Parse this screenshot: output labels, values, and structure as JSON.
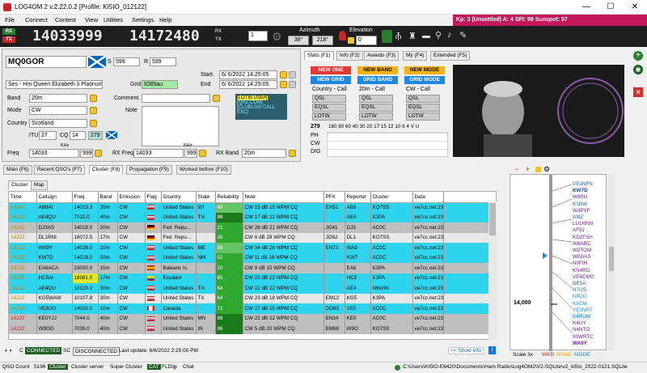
{
  "window": {
    "title": "LOG4OM 2 v.2.22.0.2 [Profile: KI5IO_012122]",
    "min": "—",
    "max": "☐",
    "close": "✕"
  },
  "menu": [
    "File",
    "Connect",
    "Contest",
    "View",
    "Utilities",
    "Settings",
    "Help"
  ],
  "kp": "Kp: 3 (Unsettled)  A: 4  SFI: 99  Sunspot: 57",
  "toolbar": {
    "rx": "RX",
    "tx": "TX",
    "rx_freq": "14033999",
    "tx_freq": "14172480",
    "rx2": "RX",
    "tx2": "TX",
    "step": "1",
    "azimuth_label": "Azimuth",
    "azimuth": "38°",
    "azimuth2": "218°",
    "elevation_label": "Elevation",
    "elevation": "0"
  },
  "qso": {
    "callsign": "MQ0GOR",
    "s_label": "S",
    "s_val": "599",
    "r_label": "R",
    "r_val": "599",
    "start_label": "Start",
    "start": "6/ 6/2022 14:25:05",
    "end_label": "End",
    "end": "6/ 6/2022 14:25:05",
    "name": "Ses - Hm Queen Elizabeth Ii Platinum Jubilee",
    "grid_label": "Grid",
    "grid": "IO85au",
    "band_label": "Band",
    "band": "20m",
    "comment_label": "Comment",
    "mode_label": "Mode",
    "mode": "CW",
    "note_label": "Note",
    "country_label": "Country",
    "country": "Scotland",
    "itu_label": "ITU",
    "itu": "27",
    "cq_label": "CQ",
    "cq": "14",
    "dxcc": "279",
    "khz1": "KHz",
    "khz2": "KHz",
    "freq_label": "Freq",
    "freq": "14033",
    "freq_dec": "999",
    "rxfreq_label": "RX Freq",
    "rxfreq": "14033",
    "rxfreq_dec": "999",
    "rxband_label": "RX Band",
    "rxband": "20m",
    "lotw": [
      "[LOTW USER]",
      "[QRZ.COM]",
      "[CLUBLOG CALL EXC]"
    ]
  },
  "stats": {
    "tabs": [
      "Stats (F1)",
      "Info (F2)",
      "Awards (F3)",
      "My (F4)",
      "Extended (F5)"
    ],
    "buttons": [
      "NEW ONE",
      "NEW BAND",
      "NEW MODE",
      "NEW GRID",
      "GRID BAND",
      "GRID MODE"
    ],
    "cols": [
      "Country - Call",
      "20m - Call",
      "CW - Call"
    ],
    "qsl": [
      "QSL",
      "EQSL",
      "LOTW"
    ],
    "dxcc": "279",
    "bands": [
      "160",
      "80",
      "60",
      "40",
      "30",
      "20",
      "17",
      "15",
      "12",
      "10",
      "6",
      "4",
      "V",
      "U"
    ],
    "rows": [
      "PH",
      "CW",
      "DIG"
    ]
  },
  "lower_tabs": [
    "Main (F6)",
    "Recent QSO's (F7)",
    "Cluster (F8)",
    "Propagation (F9)",
    "Worked before (F10)"
  ],
  "sub_tabs": [
    "Cluster",
    "Map"
  ],
  "cluster": {
    "headers": [
      "Time",
      "Callsign",
      "Freq",
      "Band",
      "Emission",
      "Flag",
      "Country",
      "State",
      "Reliability",
      "Note",
      "PFX",
      "Reporter",
      "Cluster",
      "Data"
    ],
    "rows": [
      [
        "1424Z",
        "AB9AI",
        "14015.3",
        "20m",
        "CW",
        "us",
        "United States",
        "WI",
        "49",
        "CW 15 dB 15 WPM CQ",
        "EN52",
        "AB9",
        "KO7SS",
        "ve7cc.net:23",
        "Spot",
        "cy",
        "rel-lg"
      ],
      [
        "1424Z",
        "AE4QU",
        "7032.0",
        "40m",
        "CW",
        "us",
        "United States",
        "TN",
        "98",
        "CW 17 dB 22 WPM CQ",
        "",
        "AE4",
        "K3PA",
        "ve7cc.net:23",
        "Spot",
        "cy",
        "rel-dg"
      ],
      [
        "1424Z",
        "DJ3AS",
        "14018.0",
        "20m",
        "CW",
        "de",
        "Fed. Repu...",
        "",
        "21",
        "CW 26 dB 21 WPM CQ",
        "JO41",
        "DJ3",
        "AC0C",
        "ve7cc.net:23",
        "Spot",
        "gy",
        "rel-g"
      ],
      [
        "1423Z",
        "DL1RNI",
        "18072.5",
        "17m",
        "CW",
        "de",
        "Fed. Repu...",
        "",
        "26",
        "CW  6 dB 28 WPM CQ",
        "JO62",
        "DL1",
        "KO7SS",
        "ve7cc.net:23",
        "Spot",
        "lg",
        "rel-g"
      ],
      [
        "1423Z",
        "WA9Y",
        "14026.0",
        "20m",
        "CW",
        "us",
        "United States",
        "ME",
        "49",
        "CW 34 dB 28 WPM CQ",
        "EN73",
        "WA9",
        "AC0C",
        "ve7cc.net:23",
        "Spot",
        "cy",
        "rel-lg"
      ],
      [
        "1423Z",
        "KW7D",
        "14018.0",
        "20m",
        "CW",
        "us",
        "United States",
        "NM",
        "52",
        "CW 11 dB 18 WPM CQ",
        "",
        "KW7",
        "AC0C",
        "ve7cc.net:23",
        "Spot",
        "cy",
        "rel-g"
      ],
      [
        "1423Z",
        "EA6ACA",
        "23030.0",
        "15m",
        "CW",
        "es",
        "Balearic Is.",
        "",
        "10",
        "CW  9 dB 15 WPM CQ",
        "",
        "EA6",
        "K3PA",
        "ve7cc.net:23",
        "Spot",
        "gy",
        "rel-g"
      ],
      [
        "1423Z",
        "HC5AI",
        "18081.0",
        "17m",
        "CW",
        "ec",
        "Ecuador",
        "",
        "65",
        "CW 22 dB 22 WPM CQ",
        "",
        "HC5",
        "K3PA",
        "ve7cc.net:23",
        "Spot",
        "cy",
        "rel-g"
      ],
      [
        "1422Z",
        "AE4QU",
        "10120.0",
        "30m",
        "CW",
        "us",
        "United States",
        "TN",
        "64",
        "CW 22 dB 22 WPM CQ",
        "",
        "AE4",
        "N6WIN",
        "ve7cc.net:23",
        "Spot",
        "cy",
        "rel-g"
      ],
      [
        "1422Z",
        "KG5WAW",
        "10107.8",
        "30m",
        "CW",
        "us",
        "United States",
        "TX",
        "64",
        "CW 23 dB 18 WPM CQ",
        "EM12",
        "KG5",
        "K3PA",
        "ve7cc.net:23",
        "Spot",
        "lg",
        "rel-g"
      ],
      [
        "1422Z",
        "VE3UO",
        "14020.0",
        "20m",
        "CW",
        "ca",
        "Canada",
        "",
        "71",
        "CW 27 dB 25 WPM CQ",
        "DO62",
        "VE5",
        "AC0C",
        "ve7cc.net:23",
        "Spot",
        "cy",
        "rel-g"
      ],
      [
        "1422Z",
        "KE0YJJ",
        "7044.0",
        "40m",
        "CW",
        "us",
        "United States",
        "MN",
        "96",
        "CW 22 dB 22 WPM CQ",
        "EN34",
        "KE0",
        "AC0C",
        "ve7cc.net:23",
        "Spot",
        "gy",
        "rel-dg"
      ],
      [
        "1422Z",
        "W9OG",
        "7039.0",
        "40m",
        "CW",
        "us",
        "United States",
        "IN",
        "96",
        "CW  5 dB 20 WPM CQ",
        "EM68",
        "W9O",
        "KO7SS",
        "ve7cc.net:23",
        "Spot",
        "gy",
        "rel-dg"
      ]
    ]
  },
  "cluster_status": {
    "c": "C",
    "connected": "CONNECTED",
    "sc": "SC",
    "disconnected": "DISCONNECTED",
    "last_update": "Last update: 6/6/2022 2:25:00 PM",
    "show_info": "<< Show info"
  },
  "bandmap": {
    "freq": "14,000",
    "scale": "Scale 3x",
    "legend": [
      "WKD",
      "BAND",
      "MODE"
    ],
    "calls": [
      [
        "VE3NFN",
        "#1565c0"
      ],
      [
        "KW7D",
        "#0d47a1"
      ],
      [
        "W8SU",
        "#6a1b9a"
      ],
      [
        "K1DW",
        "#1565c0"
      ],
      [
        "W3PYF",
        "#6a1b9a"
      ],
      [
        "AI8Z",
        "#1565c0"
      ],
      [
        "LU1HNN",
        "#6a1b9a"
      ],
      [
        "AF5J",
        "#6a1b9a"
      ],
      [
        "KD2FSH",
        "#6a1b9a"
      ],
      [
        "W8ARC",
        "#6a1b9a"
      ],
      [
        "W2TOM",
        "#6a1b9a"
      ],
      [
        "W0GAS",
        "#6a1b9a"
      ],
      [
        "N0FIH",
        "#6a1b9a"
      ],
      [
        "KN4RD",
        "#6a1b9a"
      ],
      [
        "VE4CMG",
        "#6a1b9a"
      ],
      [
        "NE5A",
        "#1565c0"
      ],
      [
        "N7US",
        "#1565c0"
      ],
      [
        "N8OG",
        "#1e88e5"
      ],
      [
        "K5CM",
        "#1e88e5"
      ],
      [
        "VE3NRT",
        "#1e88e5"
      ],
      [
        "K4RUM",
        "#1e88e5"
      ],
      [
        "K4UY",
        "#6a1b9a"
      ],
      [
        "N4NTO",
        "#6a1b9a"
      ],
      [
        "II0WRTC",
        "#6a1b9a"
      ],
      [
        "WA9Y",
        "#6a1b9a"
      ]
    ]
  },
  "status": {
    "qso_count_label": "QSO Count",
    "qso_count": "5196",
    "cluster": "Cluster",
    "cluster_server": "Cluster server",
    "super_cluster": "Super Cluster",
    "cat": "CAT",
    "fldigi": "FLDigi",
    "chat": "Chat",
    "db": "C:\\Users\\KI5IO-E6420\\Documents\\Ham Radio\\Log4OM2\\V2-SQLite\\v2_ki5io_2022-0121.SQLite"
  }
}
